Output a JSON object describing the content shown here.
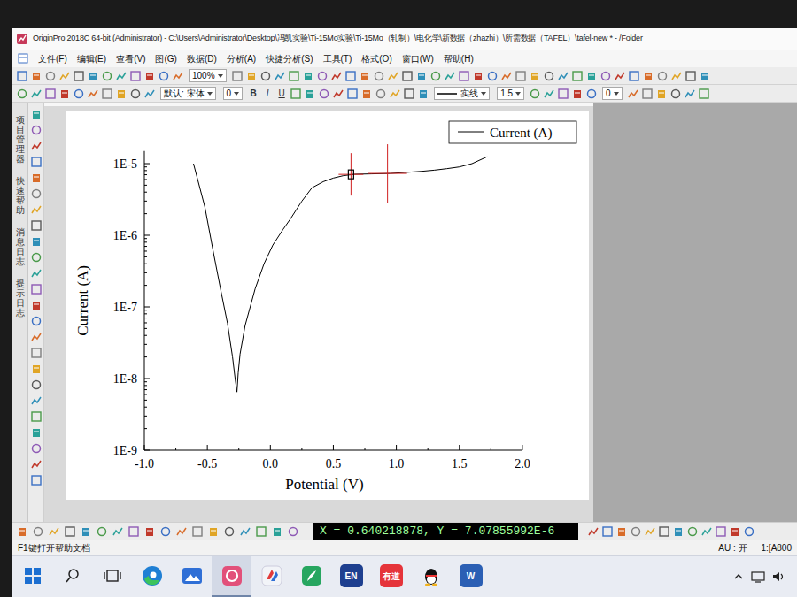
{
  "window": {
    "title": "OriginPro 2018C 64-bit (Administrator) - C:\\Users\\Administrator\\Desktop\\冯凯实验\\Ti-15Mo实验\\Ti-15Mo（轧制）\\电化学\\新数据（zhazhi）\\所需数据（TAFEL）\\tafel-new * - /Folder"
  },
  "menu": [
    "文件(F)",
    "编辑(E)",
    "查看(V)",
    "图(G)",
    "数据(D)",
    "分析(A)",
    "快捷分析(S)",
    "工具(T)",
    "格式(O)",
    "窗口(W)",
    "帮助(H)"
  ],
  "toolbar": {
    "zoom": "100%",
    "font": "默认: 宋体",
    "font_size": "0",
    "format_buttons": [
      "B",
      "I",
      "U"
    ],
    "line_style": "实线",
    "line_width": "1.5",
    "angle": "0"
  },
  "dock_tabs": [
    "项目管理器",
    "快速帮助",
    "消息日志",
    "提示日志"
  ],
  "chart": {
    "legend": "Current (A)",
    "x_title": "Potential (V)",
    "y_title": "Current (A)",
    "x_ticks": [
      "-1.0",
      "-0.5",
      "0.0",
      "0.5",
      "1.0",
      "1.5",
      "2.0"
    ],
    "y_ticks": [
      "1E-9",
      "1E-8",
      "1E-7",
      "1E-6",
      "1E-5"
    ],
    "series": [
      {
        "name": "Current (A)",
        "potential": [
          -0.61,
          -0.52,
          -0.45,
          -0.39,
          -0.34,
          -0.3,
          -0.28,
          -0.265,
          -0.255,
          -0.24,
          -0.2,
          -0.12,
          -0.05,
          0.02,
          0.1,
          0.16,
          0.25,
          0.33,
          0.42,
          0.5,
          0.58,
          0.67,
          0.8,
          0.95,
          1.06,
          1.2,
          1.3,
          1.4,
          1.5,
          1.6,
          1.72
        ],
        "current": [
          1e-05,
          2.5e-06,
          5.5e-07,
          1.6e-07,
          5.9e-08,
          2e-08,
          1e-08,
          6.5e-09,
          1.2e-08,
          2.2e-08,
          5.5e-08,
          1.8e-07,
          4e-07,
          7.3e-07,
          1.2e-06,
          1.7e-06,
          3e-06,
          4.6e-06,
          5.6e-06,
          6.3e-06,
          6.8e-06,
          7.1e-06,
          7.2e-06,
          7.3e-06,
          7.5e-06,
          7.8e-06,
          8.1e-06,
          8.5e-06,
          9e-06,
          1e-05,
          1.25e-05
        ]
      }
    ],
    "cursors": [
      {
        "x": 0.64,
        "y": 7.08e-06,
        "selected": true
      },
      {
        "x": 0.93,
        "y": 7.3e-06,
        "selected": false
      }
    ]
  },
  "readout": "X = 0.640218878, Y = 7.07855992E-6",
  "status_bar": {
    "help": "F1键打开帮助文档",
    "au": "AU : 开",
    "cell": "1:[A800"
  },
  "taskbar": {
    "apps": [
      {
        "kind": "start",
        "selected": false
      },
      {
        "kind": "search",
        "selected": false
      },
      {
        "kind": "taskview",
        "selected": false
      },
      {
        "kind": "edge",
        "selected": false
      },
      {
        "kind": "photos",
        "selected": false
      },
      {
        "kind": "origin",
        "selected": true
      },
      {
        "kind": "app",
        "selected": false
      },
      {
        "kind": "pdf",
        "selected": false
      },
      {
        "kind": "en",
        "label": "EN",
        "selected": false
      },
      {
        "kind": "youdao",
        "label": "有道",
        "selected": false
      },
      {
        "kind": "qq",
        "selected": false
      },
      {
        "kind": "word",
        "label": "W",
        "selected": false
      }
    ]
  }
}
